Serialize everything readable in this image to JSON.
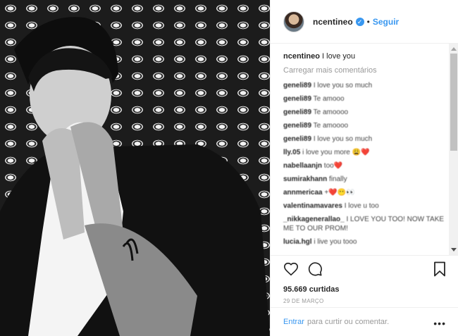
{
  "post": {
    "username": "ncentineo",
    "follow_label": "Seguir",
    "separator": "•",
    "verified_glyph": "✓",
    "caption": "I love you",
    "load_more": "Carregar mais comentários",
    "comments": [
      {
        "user": "geneli89",
        "text": "I love you so much"
      },
      {
        "user": "geneli89",
        "text": "Te amooo"
      },
      {
        "user": "geneli89",
        "text": "Te amoooo"
      },
      {
        "user": "geneli89",
        "text": "Te amoooo"
      },
      {
        "user": "geneli89",
        "text": "I love you so much"
      },
      {
        "user": "lly.05",
        "text": "i love you more 😩❤️"
      },
      {
        "user": "nabellaanjn",
        "text": "too❤️"
      },
      {
        "user": "sumirakhann",
        "text": "finally"
      },
      {
        "user": "annmericaa",
        "text": "+❤️😶👀"
      },
      {
        "user": "valentinamavares",
        "text": "I love u too"
      },
      {
        "user": "_nikkagenerallao_",
        "text": "I LOVE YOU TOO! NOW TAKE ME TO OUR PROM!"
      },
      {
        "user": "lucia.hgl",
        "text": "i live you tooo"
      },
      {
        "user": "",
        "text": ""
      }
    ],
    "likes": "95.669 curtidas",
    "date": "29 DE MARÇO",
    "login_link": "Entrar",
    "login_text": "para curtir ou comentar.",
    "more_glyph": "•••"
  },
  "icons": [
    "heart-icon",
    "comment-icon",
    "bookmark-icon",
    "verified-badge-icon",
    "scroll-up-icon",
    "scroll-down-icon"
  ],
  "colors": {
    "accent": "#3897f0",
    "text": "#262626",
    "muted": "#999999",
    "border": "#efefef"
  }
}
